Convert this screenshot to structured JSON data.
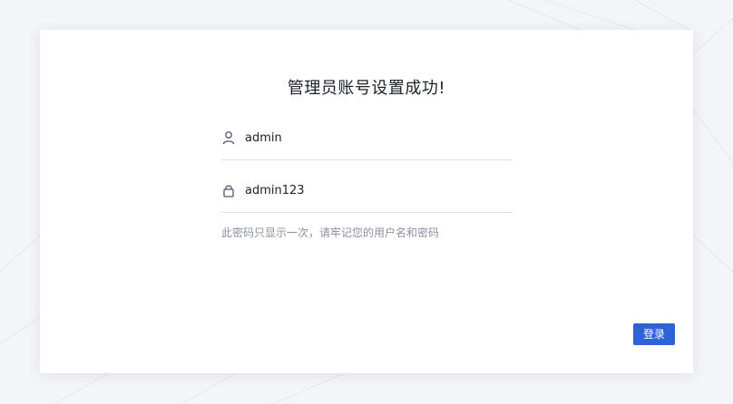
{
  "card": {
    "title": "管理员账号设置成功!",
    "username": {
      "icon": "user-icon",
      "value": "admin"
    },
    "password": {
      "icon": "lock-icon",
      "value": "admin123"
    },
    "hint": "此密码只显示一次，请牢记您的用户名和密码",
    "login_button_label": "登录"
  },
  "colors": {
    "page_background": "#f3f5f8",
    "card_background": "#ffffff",
    "accent": "#2f62d9",
    "hint_text": "#8a919f",
    "divider": "#dcdfe6"
  }
}
